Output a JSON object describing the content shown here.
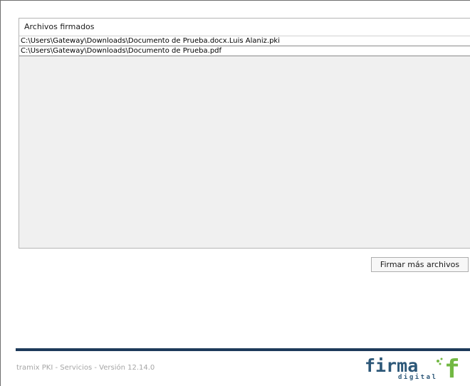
{
  "panel": {
    "header": "Archivos firmados",
    "files": [
      "C:\\Users\\Gateway\\Downloads\\Documento de Prueba.docx.Luis Alaniz.pki",
      "C:\\Users\\Gateway\\Downloads\\Documento de Prueba.pdf"
    ]
  },
  "actions": {
    "sign_more_label": "Firmar más archivos"
  },
  "footer": {
    "version_text": "tramix PKI - Servicios - Versión 12.14.0",
    "logo": {
      "word": "firma",
      "sub": "digital",
      "mark": "f",
      "colors": {
        "text": "#2c5778",
        "accent": "#72b843"
      }
    }
  }
}
